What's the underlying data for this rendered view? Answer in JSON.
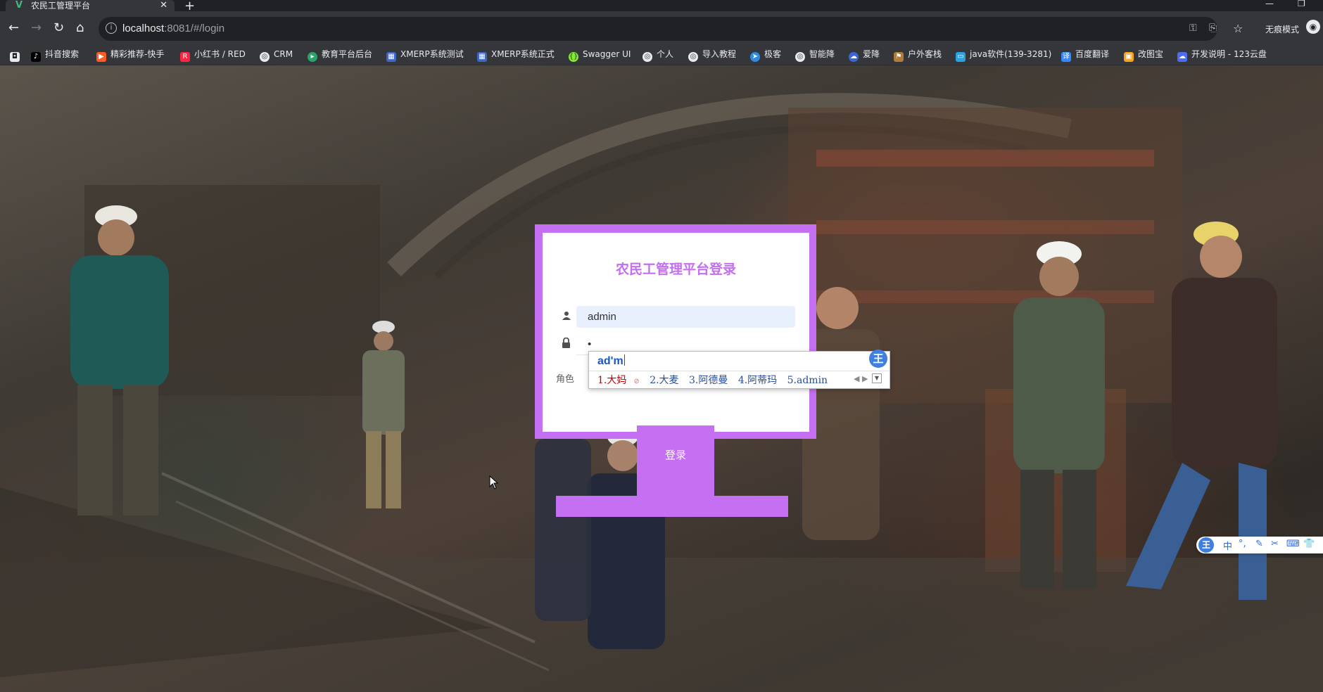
{
  "browser": {
    "tab_title": "农民工管理平台",
    "tab_close": "✕",
    "new_tab": "+",
    "url_host": "localhost",
    "url_rest": ":8081/#/login",
    "incognito_label": "无痕模式"
  },
  "bookmarks": [
    {
      "label": "抖音搜索",
      "icon": "tiktok-icon",
      "color": "#111111"
    },
    {
      "label": "精彩推荐-快手",
      "icon": "kuaishou-icon",
      "color": "#ff5a24"
    },
    {
      "label": "小红书 / RED",
      "icon": "red-icon",
      "color": "#ff2442"
    },
    {
      "label": "CRM",
      "icon": "globe-icon",
      "color": "#5f6368"
    },
    {
      "label": "教育平台后台",
      "icon": "play-icon",
      "color": "#2aa46a"
    },
    {
      "label": "XMERP系统测试",
      "icon": "erp-icon",
      "color": "#3c67c8"
    },
    {
      "label": "XMERP系统正式",
      "icon": "erp-icon",
      "color": "#3c67c8"
    },
    {
      "label": "Swagger UI",
      "icon": "swagger-icon",
      "color": "#85ea2d"
    },
    {
      "label": "个人",
      "icon": "globe-icon",
      "color": "#5f6368"
    },
    {
      "label": "导入教程",
      "icon": "globe-icon",
      "color": "#5f6368"
    },
    {
      "label": "极客",
      "icon": "paper-plane-icon",
      "color": "#2f8ae5"
    },
    {
      "label": "智能降",
      "icon": "globe-icon",
      "color": "#5f6368"
    },
    {
      "label": "爱降",
      "icon": "cloud-icon",
      "color": "#3a66d9"
    },
    {
      "label": "户外客栈",
      "icon": "flag-icon",
      "color": "#b07c3a"
    },
    {
      "label": "java软件(139-3281)",
      "icon": "tv-icon",
      "color": "#2aa1e0"
    },
    {
      "label": "百度翻译",
      "icon": "translate-icon",
      "color": "#3388ff"
    },
    {
      "label": "改图宝",
      "icon": "image-icon",
      "color": "#f7a21b"
    },
    {
      "label": "开发说明 - 123云盘",
      "icon": "cloud-drive-icon",
      "color": "#4a6cf7"
    }
  ],
  "login": {
    "title": "农民工管理平台登录",
    "username_value": "admin",
    "password_mask": "•",
    "role_label": "角色",
    "login_button": "登录"
  },
  "ime": {
    "composition": "ad'm",
    "candidates": [
      "1.大妈",
      "2.大麦",
      "3.阿德曼",
      "4.阿蒂玛",
      "5.admin"
    ],
    "logo": "王",
    "toolbar": [
      "中",
      "°,",
      "✎",
      "✂",
      "⌨",
      "👕"
    ]
  }
}
